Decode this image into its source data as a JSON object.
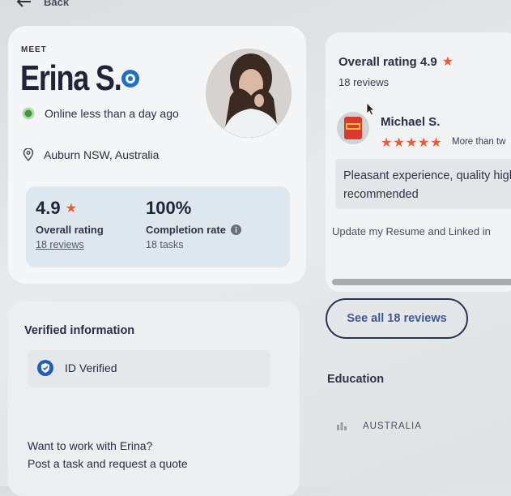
{
  "nav": {
    "back_label": "Back"
  },
  "profile": {
    "eyebrow": "MEET",
    "name": "Erina S.",
    "online_status": "Online less than a day ago",
    "location": "Auburn NSW, Australia",
    "stats": {
      "rating_value": "4.9",
      "rating_label": "Overall rating",
      "rating_reviews": "18 reviews",
      "completion_value": "100%",
      "completion_label": "Completion rate",
      "completion_tasks": "18 tasks"
    }
  },
  "reviews": {
    "overall_title": "Overall rating 4.9",
    "count": "18 reviews",
    "reviewer_name": "Michael S.",
    "reviewer_stars": "★★★★★",
    "reviewer_meta": "More than tw",
    "review_text": "Pleasant experience, quality highly recommended",
    "review_snippet": "Update my Resume and Linked in",
    "see_all_label": "See all 18 reviews"
  },
  "education": {
    "title": "Education",
    "item": "AUSTRALIA"
  },
  "verified": {
    "title": "Verified information",
    "id_label": "ID Verified",
    "cta_title": "Want to work with Erina?",
    "cta_sub": "Post a task and request a quote"
  },
  "colors": {
    "accent_blue": "#1f6fd1",
    "star_red": "#ee5a34",
    "online_green": "#3d9a3a",
    "text_dark": "#1f2438"
  },
  "icons": [
    "back-arrow-icon",
    "verified-badge-icon",
    "online-indicator-icon",
    "location-pin-icon",
    "star-icon",
    "info-icon",
    "shield-check-icon",
    "reviewer-logo-icon",
    "education-icon",
    "cursor-icon"
  ]
}
